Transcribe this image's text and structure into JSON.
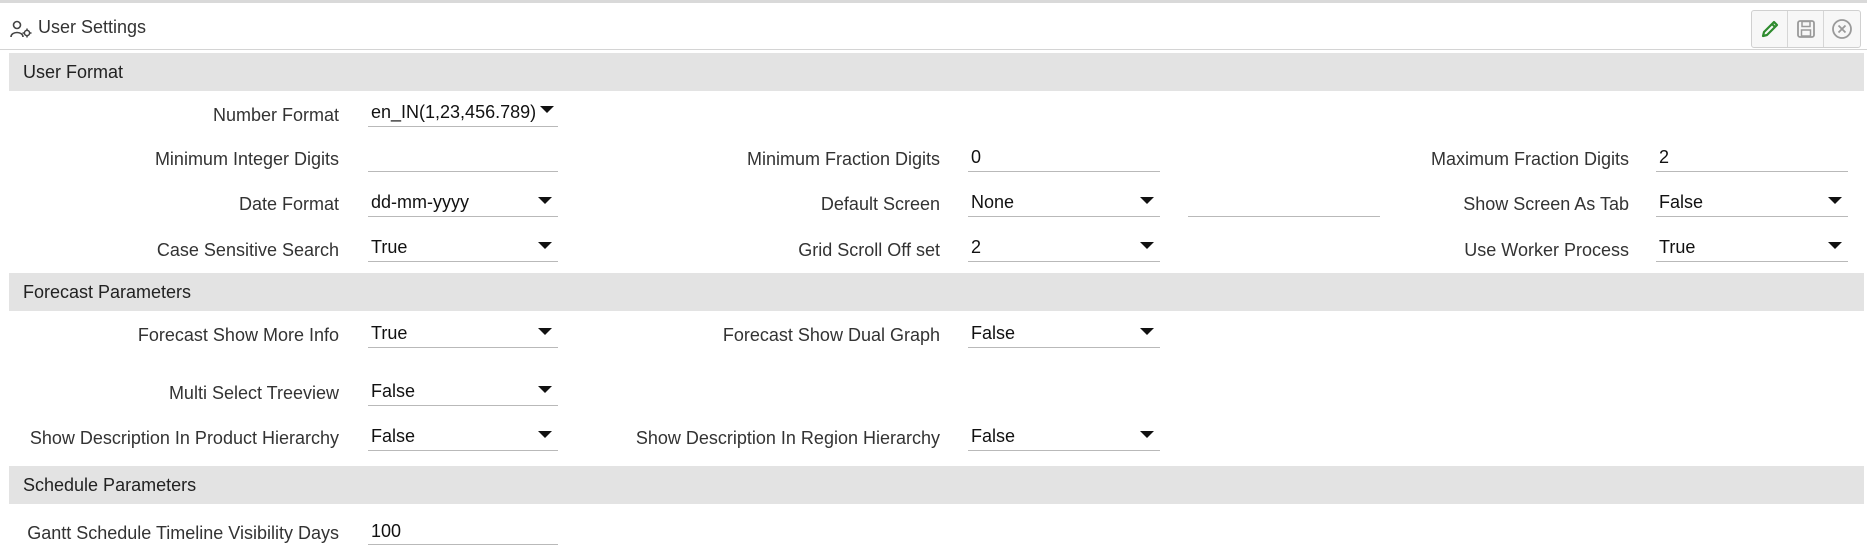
{
  "window": {
    "title": "User Settings",
    "icon": "user-settings-icon"
  },
  "toolbar": {
    "edit": "pencil-icon",
    "save": "save-icon",
    "close": "close-circle-icon"
  },
  "sections": {
    "user_format": {
      "title": "User Format",
      "number_format": {
        "label": "Number Format",
        "value": "en_IN(1,23,456.789)"
      },
      "min_integer_digits": {
        "label": "Minimum Integer Digits",
        "value": ""
      },
      "min_fraction_digits": {
        "label": "Minimum Fraction Digits",
        "value": "0"
      },
      "max_fraction_digits": {
        "label": "Maximum Fraction Digits",
        "value": "2"
      },
      "date_format": {
        "label": "Date Format",
        "value": "dd-mm-yyyy"
      },
      "default_screen": {
        "label": "Default Screen",
        "value": "None",
        "extra_value": ""
      },
      "show_screen_as_tab": {
        "label": "Show Screen As Tab",
        "value": "False"
      },
      "case_sensitive_search": {
        "label": "Case Sensitive Search",
        "value": "True"
      },
      "grid_scroll_offset": {
        "label": "Grid Scroll Off set",
        "value": "2"
      },
      "use_worker_process": {
        "label": "Use Worker Process",
        "value": "True"
      }
    },
    "forecast_parameters": {
      "title": "Forecast Parameters",
      "show_more_info": {
        "label": "Forecast Show More Info",
        "value": "True"
      },
      "show_dual_graph": {
        "label": "Forecast Show Dual Graph",
        "value": "False"
      },
      "multi_select_treeview": {
        "label": "Multi Select Treeview",
        "value": "False"
      },
      "desc_product_hierarchy": {
        "label": "Show Description In Product Hierarchy",
        "value": "False"
      },
      "desc_region_hierarchy": {
        "label": "Show Description In Region Hierarchy",
        "value": "False"
      }
    },
    "schedule_parameters": {
      "title": "Schedule Parameters",
      "gantt_visibility_days": {
        "label": "Gantt Schedule Timeline Visibility Days",
        "value": "100"
      }
    }
  },
  "colors": {
    "section_bg": "#e3e3e3",
    "edit_icon": "#2e8b2e",
    "icon_gray": "#9a9a9a"
  }
}
